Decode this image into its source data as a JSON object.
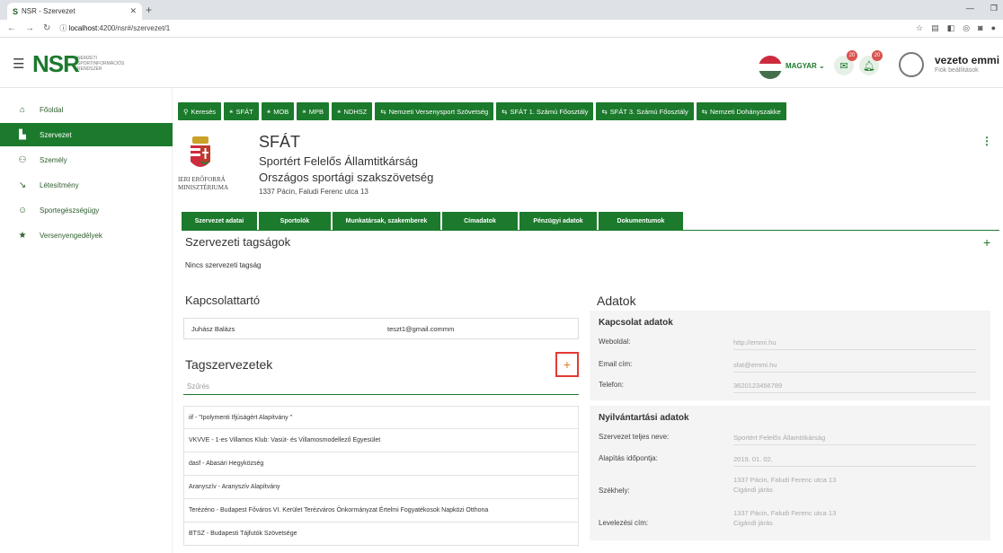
{
  "browser": {
    "tab_title": "NSR - Szervezet",
    "url_host": "localhost",
    "url_rest": ":4200/nsr#/szervezet/1"
  },
  "app": {
    "logo": "NSR",
    "logo_sub": "NEMZETI SPORTINFORMÁCIÓS RENDSZER",
    "language": "MAGYAR",
    "badge1": "20",
    "badge2": "20",
    "user_name": "vezeto emmi",
    "user_sub": "Fiók beállítások"
  },
  "sidebar": {
    "items": [
      {
        "label": "Főoldal",
        "icon": "home-icon"
      },
      {
        "label": "Szervezet",
        "icon": "building-icon"
      },
      {
        "label": "Személy",
        "icon": "people-icon"
      },
      {
        "label": "Létesítmény",
        "icon": "facility-icon"
      },
      {
        "label": "Sportegészségügy",
        "icon": "health-icon"
      },
      {
        "label": "Versenyengedélyek",
        "icon": "star-icon"
      }
    ]
  },
  "top_tabs": [
    "Keresés",
    "SFÁT",
    "MOB",
    "MPB",
    "NDHSZ",
    "Nemzeti Versenysport Szövetség",
    "SFÁT 1. Számú Főosztály",
    "SFÁT 3. Számú Főosztály",
    "Nemzeti Dohányszakke"
  ],
  "org": {
    "ministry_line1": "IERI ERŐFORRÁ",
    "ministry_line2": "MINISZTÉRIUMA",
    "short": "SFÁT",
    "name1": "Sportért Felelős Államtitkárság",
    "name2": "Országos sportági szakszövetség",
    "address": "1337 Pácin, Faludi Ferenc utca 13"
  },
  "sub_tabs": [
    "Szervezet adatai",
    "Sportolók",
    "Munkatársak, szakemberek",
    "Címadatok",
    "Pénzügyi adatok",
    "Dokumentumok"
  ],
  "membership": {
    "title": "Szervezeti tagságok",
    "empty": "Nincs szervezeti tagság"
  },
  "contact": {
    "title": "Kapcsolattartó",
    "name": "Juhász Balázs",
    "email": "teszt1@gmail.commm"
  },
  "members": {
    "title": "Tagszervezetek",
    "filter_placeholder": "Szűrés",
    "rows": [
      "iif - \"Ipolymenti Ifjúságért Alapítvány \"",
      "VKVVE - 1-es Villamos Klub: Vasút- és Villamosmodellező Egyesület",
      "dasf - Abasári Hegyközség",
      "Aranyszív - Aranyszív Alapítvány",
      "Terézéno - Budapest Főváros VI. Kerület Terézváros Önkormányzat Értelmi Fogyatékosok Napközi Otthona",
      "BTSZ - Budapesti Tájfutók Szövetsége"
    ]
  },
  "data_panel": {
    "title": "Adatok",
    "contact_title": "Kapcsolat adatok",
    "website_label": "Weboldal:",
    "website": "http://emmi.hu",
    "email_label": "Email cím:",
    "email": "sfat@emmi.hu",
    "phone_label": "Telefon:",
    "phone": "3620123456789",
    "reg_title": "Nyilvántartási adatok",
    "fullname_label": "Szervezet teljes neve:",
    "fullname": "Sportért Felelős Államtitkárság",
    "founded_label": "Alapítás időpontja:",
    "founded": "2019. 01. 02.",
    "seat_label": "Székhely:",
    "seat1": "1337 Pácin, Faludi Ferenc utca 13",
    "seat2": "Cigándi járás",
    "mail_label": "Levelezési cím:",
    "mail1": "1337 Pácin, Faludi Ferenc utca 13",
    "mail2": "Cigándi járás"
  },
  "colors": {
    "brand": "#1b7a2c",
    "highlight": "#e53935"
  }
}
